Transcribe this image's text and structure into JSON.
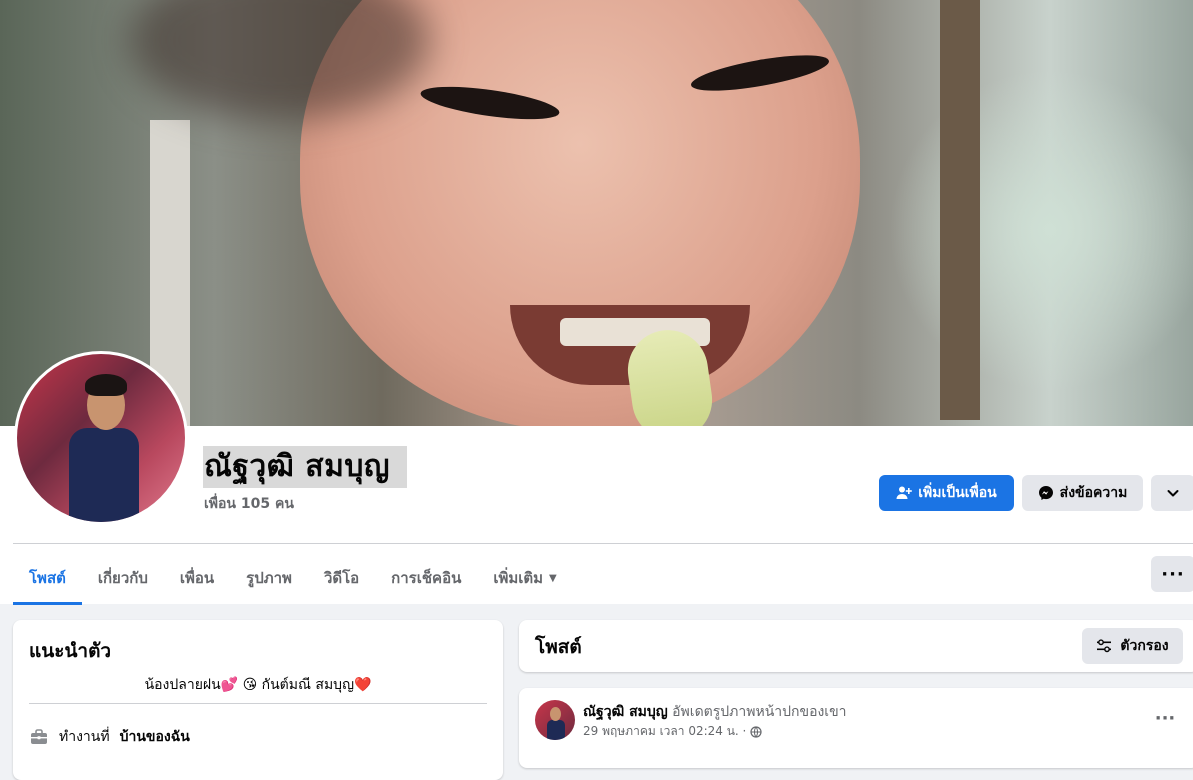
{
  "profile": {
    "name": "ณัฐวุฒิ สมบุญ",
    "friends": "เพื่อน 105 คน",
    "add_friend_label": "เพิ่มเป็นเพื่อน",
    "message_label": "ส่งข้อความ"
  },
  "tabs": [
    {
      "label": "โพสต์"
    },
    {
      "label": "เกี่ยวกับ"
    },
    {
      "label": "เพื่อน"
    },
    {
      "label": "รูปภาพ"
    },
    {
      "label": "วิดีโอ"
    },
    {
      "label": "การเช็คอิน"
    },
    {
      "label": "เพิ่มเติม"
    }
  ],
  "more_icon": "···",
  "intro": {
    "title": "แนะนำตัว",
    "bio": "น้องปลายฝน💕 😘 กันต์มณี สมบุญ❤️",
    "work_label": "ทำงานที่",
    "work_place": "บ้านของฉัน"
  },
  "posts": {
    "title": "โพสต์",
    "filter_label": "ตัวกรอง"
  },
  "post": {
    "author": "ณัฐวุฒิ สมบุญ",
    "action": "อัพเดตรูปภาพหน้าปกของเขา",
    "timestamp": "29 พฤษภาคม เวลา 02:24 น. ·"
  },
  "colors": {
    "accent": "#1b74e4",
    "background": "#f0f2f5",
    "button_grey": "#e4e6eb",
    "secondary_text": "#65676b"
  },
  "icons": [
    "add-friend-icon",
    "messenger-icon",
    "chevron-down-icon",
    "caret-down-icon",
    "more-icon",
    "briefcase-icon",
    "filter-icon",
    "globe-icon"
  ]
}
